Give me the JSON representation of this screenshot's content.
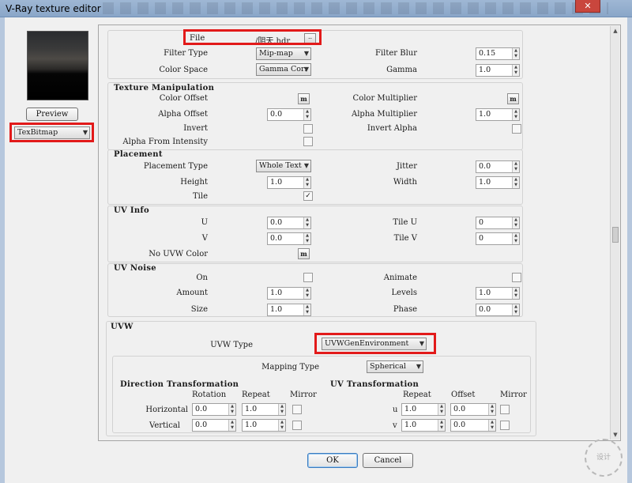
{
  "window": {
    "title": "V-Ray texture editor",
    "close_icon": "✕"
  },
  "left": {
    "preview_label": "Preview",
    "texmap_type": "TexBitmap"
  },
  "file": {
    "label": "File",
    "value": "/阴天.hdr",
    "browse_label": ".."
  },
  "filter": {
    "type_label": "Filter Type",
    "type_value": "Mip-map",
    "blur_label": "Filter Blur",
    "blur_value": "0.15",
    "colorspace_label": "Color Space",
    "colorspace_value": "Gamma Corr",
    "gamma_label": "Gamma",
    "gamma_value": "1.0"
  },
  "texture_manipulation": {
    "title": "Texture Manipulation",
    "color_offset_label": "Color Offset",
    "color_multiplier_label": "Color Multiplier",
    "map_btn": "m",
    "alpha_offset_label": "Alpha Offset",
    "alpha_offset_value": "0.0",
    "alpha_multiplier_label": "Alpha Multiplier",
    "alpha_multiplier_value": "1.0",
    "invert_label": "Invert",
    "invert_alpha_label": "Invert Alpha",
    "alpha_from_intensity_label": "Alpha From Intensity"
  },
  "placement": {
    "title": "Placement",
    "type_label": "Placement Type",
    "type_value": "Whole Text",
    "jitter_label": "Jitter",
    "jitter_value": "0.0",
    "height_label": "Height",
    "height_value": "1.0",
    "width_label": "Width",
    "width_value": "1.0",
    "tile_label": "Tile",
    "tile_checked": "✓"
  },
  "uv_info": {
    "title": "UV Info",
    "u_label": "U",
    "u_value": "0.0",
    "tile_u_label": "Tile U",
    "tile_u_value": "0",
    "v_label": "V",
    "v_value": "0.0",
    "tile_v_label": "Tile V",
    "tile_v_value": "0",
    "no_uvw_color_label": "No UVW Color"
  },
  "uv_noise": {
    "title": "UV Noise",
    "on_label": "On",
    "animate_label": "Animate",
    "amount_label": "Amount",
    "amount_value": "1.0",
    "levels_label": "Levels",
    "levels_value": "1.0",
    "size_label": "Size",
    "size_value": "1.0",
    "phase_label": "Phase",
    "phase_value": "0.0"
  },
  "uvw": {
    "title": "UVW",
    "type_label": "UVW Type",
    "type_value": "UVWGenEnvironment",
    "mapping_label": "Mapping Type",
    "mapping_value": "Spherical",
    "direction_title": "Direction Transformation",
    "uv_title": "UV Transformation",
    "rotation_header": "Rotation",
    "repeat_header": "Repeat",
    "mirror_header": "Mirror",
    "offset_header": "Offset",
    "horizontal_label": "Horizontal",
    "vertical_label": "Vertical",
    "h_rotation": "0.0",
    "h_repeat": "1.0",
    "v_rotation": "0.0",
    "v_repeat": "1.0",
    "u_label": "u",
    "v_label": "v",
    "u_repeat": "1.0",
    "u_offset": "0.0",
    "v_offset": "0.0"
  },
  "footer": {
    "ok_label": "OK",
    "cancel_label": "Cancel"
  },
  "icons": {
    "spin_up": "▲",
    "spin_down": "▼",
    "dropdown": "▼",
    "scroll_up": "▲",
    "scroll_down": "▼"
  },
  "watermark_text": "设计",
  "highlight_color": "#e21a1a"
}
